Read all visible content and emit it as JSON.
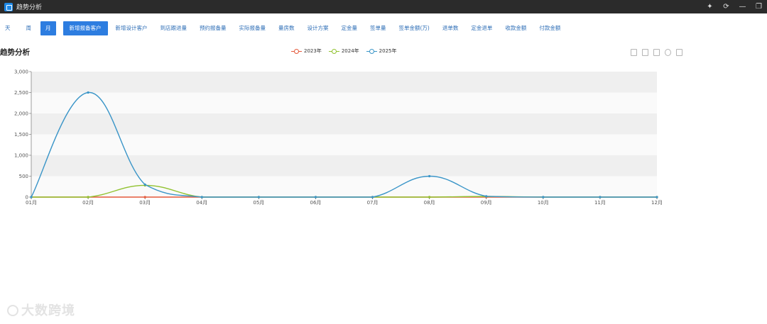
{
  "window": {
    "title": "趋势分析",
    "controls": [
      "pin-icon",
      "refresh-icon",
      "minimize-icon",
      "restore-icon"
    ]
  },
  "nav": {
    "period_tabs": [
      "天",
      "周",
      "月"
    ],
    "active_period": "月",
    "metric_tabs": [
      "新增报备客户",
      "新增设计客户",
      "到店跟进量",
      "预约报备量",
      "实际报备量",
      "量房数",
      "设计方案",
      "定金量",
      "签单量",
      "签单金额(万)",
      "退单数",
      "定金退单",
      "收款金额",
      "付款金额"
    ],
    "active_metric": "新增报备客户"
  },
  "chart_title": "趋势分析",
  "watermark": "大数跨境",
  "colors": {
    "accent": "#2d7de0",
    "s2023": "#e4593b",
    "s2024": "#91c230",
    "s2025": "#3a95c8"
  },
  "chart_data": {
    "type": "line",
    "categories": [
      "01月",
      "02月",
      "03月",
      "04月",
      "05月",
      "06月",
      "07月",
      "08月",
      "09月",
      "10月",
      "11月",
      "12月"
    ],
    "ylim": [
      0,
      3000
    ],
    "yticks": [
      "0",
      "500",
      "1,000",
      "1,500",
      "2,000",
      "2,500",
      "3,000"
    ],
    "legend_position": "top-center",
    "grid": "horizontal bands",
    "series": [
      {
        "name": "2023年",
        "color": "#e4593b",
        "values": [
          0,
          0,
          0,
          0,
          0,
          0,
          0,
          0,
          0,
          0,
          0,
          0
        ]
      },
      {
        "name": "2024年",
        "color": "#91c230",
        "values": [
          0,
          0,
          280,
          0,
          0,
          0,
          0,
          0,
          15,
          0,
          0,
          0
        ]
      },
      {
        "name": "2025年",
        "color": "#3a95c8",
        "values": [
          0,
          2500,
          300,
          0,
          0,
          0,
          0,
          500,
          20,
          0,
          0,
          0
        ]
      }
    ]
  }
}
